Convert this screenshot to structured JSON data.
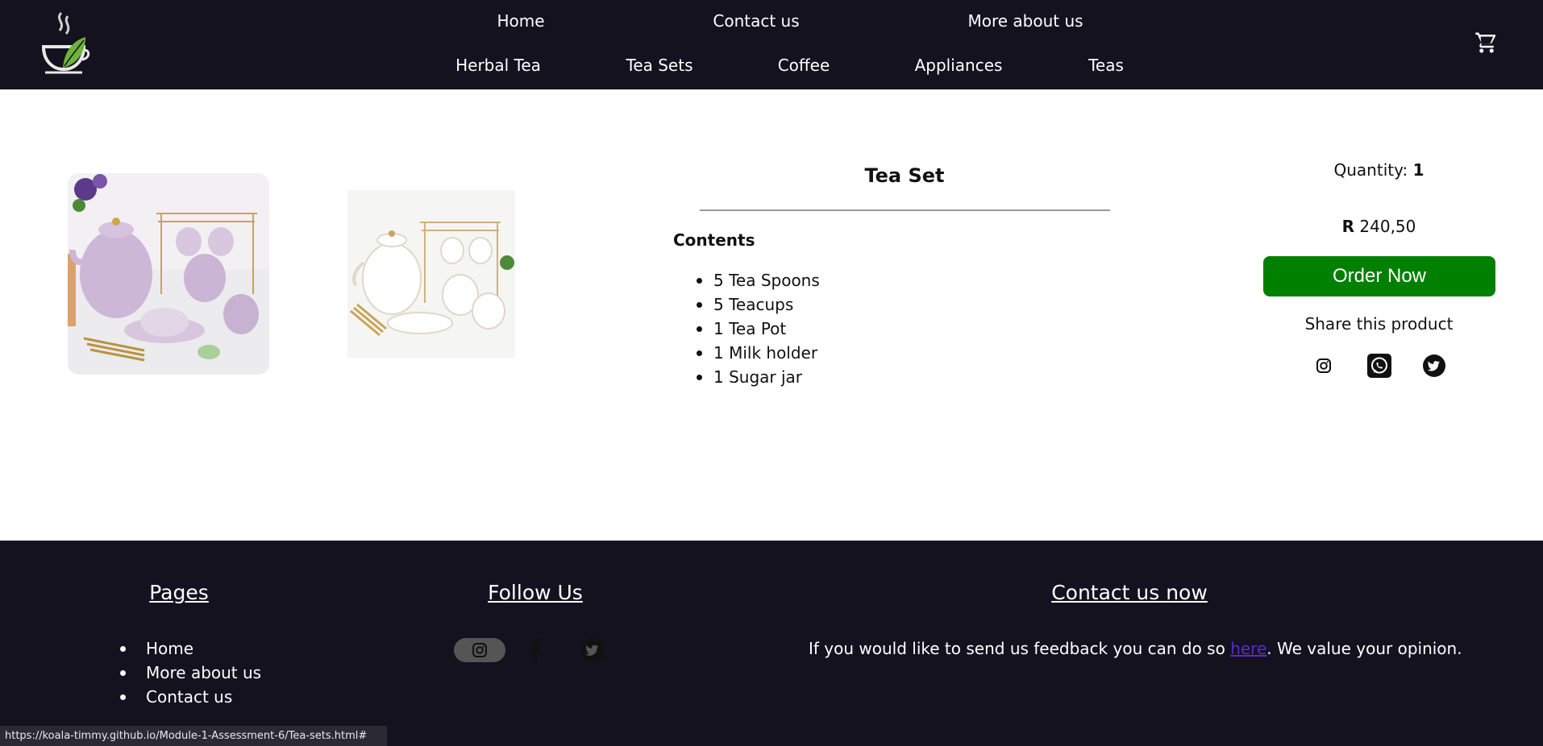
{
  "header": {
    "nav_top": [
      {
        "label": "Home"
      },
      {
        "label": "Contact us"
      },
      {
        "label": "More about us"
      }
    ],
    "nav_bottom": [
      {
        "label": "Herbal Tea"
      },
      {
        "label": "Tea Sets"
      },
      {
        "label": "Coffee"
      },
      {
        "label": "Appliances"
      },
      {
        "label": "Teas"
      }
    ],
    "logo_icon": "teacup-leaf-logo",
    "cart_icon": "cart-icon"
  },
  "product": {
    "title": "Tea Set",
    "contents_heading": "Contents",
    "contents": [
      "5 Tea Spoons",
      "5 Teacups",
      "1 Tea Pot",
      "1 Milk holder",
      "1 Sugar jar"
    ],
    "quantity_label": "Quantity:",
    "quantity_value": "1",
    "price_currency": "R",
    "price_value": "240,50",
    "order_label": "Order Now",
    "share_label": "Share this product",
    "share_icons": [
      "instagram-icon",
      "whatsapp-icon",
      "twitter-icon"
    ]
  },
  "footer": {
    "pages_heading": "Pages",
    "pages": [
      "Home",
      "More about us",
      "Contact us"
    ],
    "follow_heading": "Follow Us",
    "follow_icons": [
      "instagram-icon",
      "facebook-icon",
      "twitter-icon"
    ],
    "contact_heading": "Contact us now",
    "feedback_before": "If you would like to send us feedback you can do so ",
    "feedback_link": "here",
    "feedback_after": ". We value your opinion."
  },
  "status_bar": {
    "url": "https://koala-timmy.github.io/Module-1-Assessment-6/Tea-sets.html#"
  },
  "colors": {
    "header_bg": "#14121f",
    "order_button": "#008000",
    "link_visited": "#5a2ac8"
  }
}
